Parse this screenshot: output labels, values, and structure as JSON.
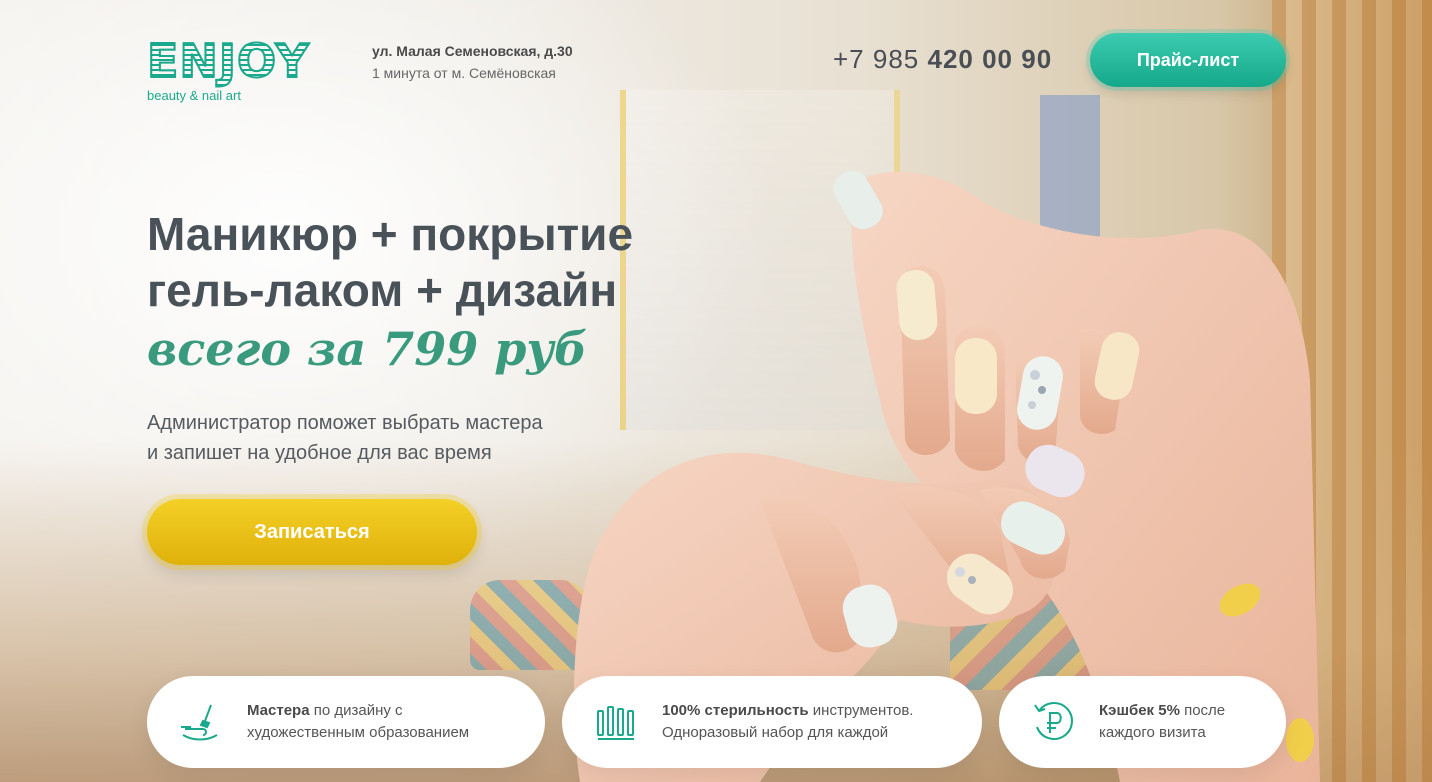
{
  "header": {
    "logo_text": "ENJOY",
    "logo_subtitle": "beauty & nail art",
    "address_street": "ул. Малая Семеновская, д.30",
    "address_metro": "1 минута от м. Семёновская",
    "phone_prefix": "+7 985",
    "phone_number": "420 00 90",
    "price_list_label": "Прайс-лист"
  },
  "hero": {
    "title_line1": "Маникюр + покрытие",
    "title_line2": "гель-лаком + дизайн",
    "price_text": "всего за 799 руб",
    "desc_line1": "Администратор поможет выбрать мастера",
    "desc_line2": "и запишет на удобное для вас время",
    "signup_label": "Записаться"
  },
  "features": [
    {
      "icon": "nail-brush-icon",
      "bold": "Мастера",
      "text_after_bold": " по дизайну с",
      "line2": "художественным образованием"
    },
    {
      "icon": "sterile-tools-icon",
      "bold": "100% стерильность",
      "text_after_bold": " инструментов.",
      "line2": "Одноразовый набор для каждой"
    },
    {
      "icon": "ruble-cashback-icon",
      "bold": "Кэшбек 5%",
      "text_after_bold": " после",
      "line2": "каждого визита"
    }
  ],
  "colors": {
    "brand_teal": "#1aa98d",
    "accent_yellow": "#f4d026",
    "text_dark": "#4a5259",
    "price_green": "#3a9a7e"
  }
}
